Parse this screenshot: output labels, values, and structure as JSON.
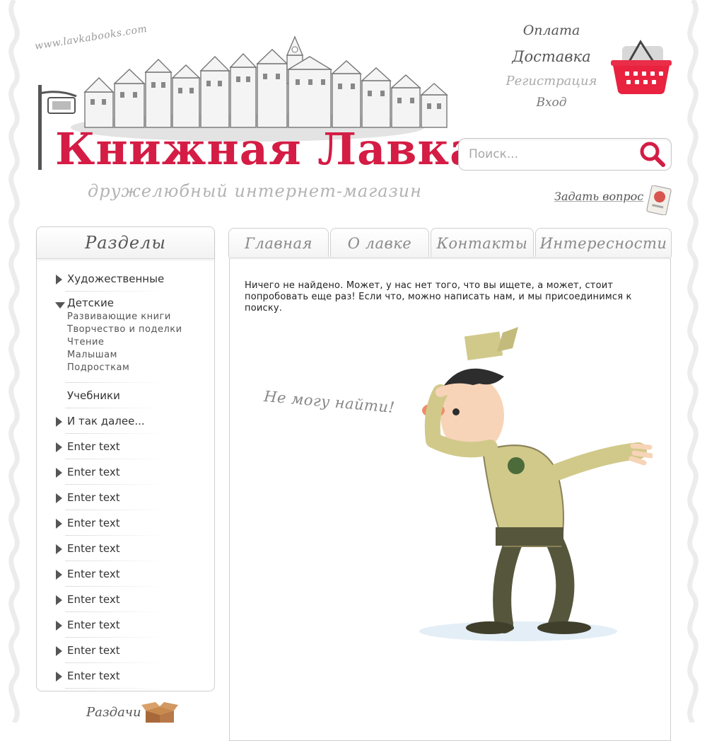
{
  "header": {
    "site_url": "www.lavkabooks.com",
    "logo_text": "Книжная Лавка",
    "tagline": "дружелюбный интернет-магазин",
    "links": {
      "payment": "Оплата",
      "delivery": "Доставка",
      "register": "Регистрация",
      "login": "Вход"
    },
    "search": {
      "placeholder": "Поиск..."
    },
    "ask_question": "Задать вопрос"
  },
  "sidebar": {
    "title": "Разделы",
    "items": [
      {
        "label": "Художественные"
      },
      {
        "label": "Детские",
        "subitems": [
          "Развивающие книги",
          "Творчество и поделки",
          "Чтение",
          "Малышам",
          "Подросткам"
        ]
      },
      {
        "label": "Учебники"
      },
      {
        "label": "И так далее..."
      },
      {
        "label": "Enter text"
      },
      {
        "label": "Enter text"
      },
      {
        "label": "Enter text"
      },
      {
        "label": "Enter text"
      },
      {
        "label": "Enter text"
      },
      {
        "label": "Enter text"
      },
      {
        "label": "Enter text"
      },
      {
        "label": "Enter text"
      },
      {
        "label": "Enter text"
      },
      {
        "label": "Enter text"
      }
    ],
    "handouts": "Раздачи"
  },
  "tabs": [
    "Главная",
    "О лавке",
    "Контакты",
    "Интересности"
  ],
  "content": {
    "message": "Ничего не найдено. Может, у нас нет того, что вы ищете, а может, стоит попробовать еще раз! Если что, можно написать нам, и мы присоединимся к поиску.",
    "illustration_caption": "Не могу найти!"
  },
  "colors": {
    "brand_red": "#d41c45",
    "text_gray": "#555555",
    "border_gray": "#cfcfcf"
  },
  "icons": [
    "lamp-post-icon",
    "basket-icon",
    "search-icon",
    "question-card-icon",
    "box-icon"
  ]
}
